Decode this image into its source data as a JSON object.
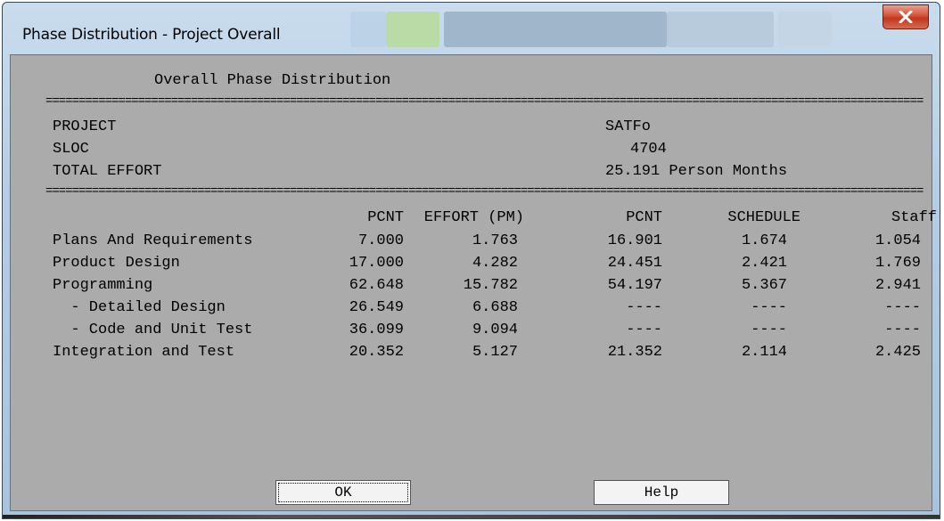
{
  "window": {
    "title": "Phase Distribution - Project Overall",
    "close_symbol": "X"
  },
  "report": {
    "heading": "Overall Phase Distribution",
    "separator": "================================================================================================================================================",
    "project_label": "PROJECT",
    "project_value": "SATFo",
    "sloc_label": "SLOC",
    "sloc_value": "4704",
    "effort_label": "TOTAL EFFORT",
    "effort_value": "25.191 Person Months",
    "columns": [
      "PCNT",
      "EFFORT (PM)",
      "PCNT",
      "SCHEDULE",
      "Staff"
    ],
    "rows": [
      {
        "phase": "Plans And Requirements",
        "pcnt": "7.000",
        "effort": "1.763",
        "pcnt2": "16.901",
        "schedule": "1.674",
        "staff": "1.054"
      },
      {
        "phase": "Product Design",
        "pcnt": "17.000",
        "effort": "4.282",
        "pcnt2": "24.451",
        "schedule": "2.421",
        "staff": "1.769"
      },
      {
        "phase": "Programming",
        "pcnt": "62.648",
        "effort": "15.782",
        "pcnt2": "54.197",
        "schedule": "5.367",
        "staff": "2.941"
      },
      {
        "phase": "  - Detailed Design",
        "pcnt": "26.549",
        "effort": "6.688",
        "pcnt2": "----",
        "schedule": "----",
        "staff": "----"
      },
      {
        "phase": "  - Code and Unit Test",
        "pcnt": "36.099",
        "effort": "9.094",
        "pcnt2": "----",
        "schedule": "----",
        "staff": "----"
      },
      {
        "phase": "Integration and Test",
        "pcnt": "20.352",
        "effort": "5.127",
        "pcnt2": "21.352",
        "schedule": "2.114",
        "staff": "2.425"
      }
    ]
  },
  "buttons": {
    "ok": "OK",
    "help": "Help"
  },
  "colors": {
    "client_bg": "#ababab",
    "titlebar": "#b4cde4",
    "close": "#c2361f"
  }
}
